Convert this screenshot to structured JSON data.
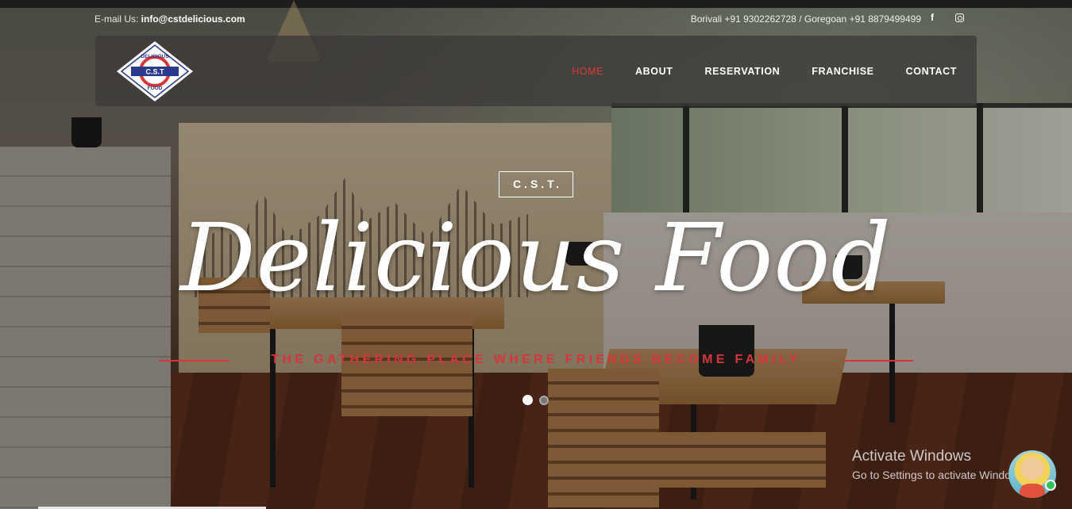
{
  "topbar": {
    "email_label": "E-mail Us: ",
    "email": "info@cstdelicious.com",
    "phones": "Borivali +91 9302262728 / Goregoan +91 8879499499",
    "facebook_glyph": "f",
    "facebook_icon": "facebook-icon",
    "instagram_icon": "instagram-icon"
  },
  "logo": {
    "top_text": "DELICIOUS",
    "center_text": "C.S.T",
    "bottom_text": "FOOD"
  },
  "nav": {
    "items": [
      {
        "label": "HOME",
        "active": true
      },
      {
        "label": "ABOUT",
        "active": false
      },
      {
        "label": "RESERVATION",
        "active": false
      },
      {
        "label": "FRANCHISE",
        "active": false
      },
      {
        "label": "CONTACT",
        "active": false
      }
    ]
  },
  "hero": {
    "badge": "C.S.T.",
    "headline": "Delicious Food",
    "tagline": "THE GATHERING PLACE WHERE FRIENDS BECOME FAMILY",
    "slides_total": 2,
    "active_slide": 1
  },
  "watermark": {
    "title": "Activate Windows",
    "subtitle": "Go to Settings to activate Windo"
  },
  "colors": {
    "accent": "#d9393a",
    "navbar_bg": "rgba(60,58,56,0.78)",
    "text": "#ffffff"
  },
  "chat": {
    "icon": "chat-avatar-icon",
    "status": "online"
  }
}
